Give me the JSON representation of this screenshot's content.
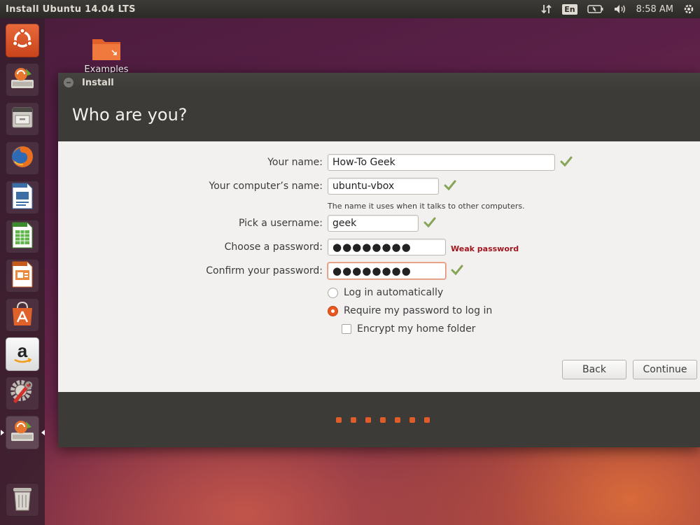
{
  "panel": {
    "title": "Install Ubuntu 14.04 LTS",
    "language": "En",
    "clock": "8:58 AM"
  },
  "desktop": {
    "icons": [
      {
        "label": "Examples",
        "icon": "folder-icon"
      }
    ]
  },
  "launcher": {
    "items": [
      {
        "name": "ubuntu-dash",
        "icon": "ubuntu-logo-icon"
      },
      {
        "name": "installer",
        "icon": "installer-icon"
      },
      {
        "name": "files",
        "icon": "file-cabinet-icon"
      },
      {
        "name": "firefox",
        "icon": "firefox-icon"
      },
      {
        "name": "writer",
        "icon": "writer-icon"
      },
      {
        "name": "calc",
        "icon": "calc-icon"
      },
      {
        "name": "impress",
        "icon": "impress-icon"
      },
      {
        "name": "software-center",
        "icon": "shopping-bag-icon"
      },
      {
        "name": "amazon",
        "icon": "amazon-icon"
      },
      {
        "name": "system-settings",
        "icon": "settings-icon"
      },
      {
        "name": "installer-running",
        "icon": "installer-icon"
      },
      {
        "name": "trash",
        "icon": "trash-icon"
      }
    ]
  },
  "window": {
    "title": "Install",
    "page_title": "Who are you?"
  },
  "form": {
    "your_name": {
      "label": "Your name:",
      "value": "How-To Geek"
    },
    "computer_name": {
      "label": "Your computer’s name:",
      "value": "ubuntu-vbox",
      "hint": "The name it uses when it talks to other computers."
    },
    "username": {
      "label": "Pick a username:",
      "value": "geek"
    },
    "password": {
      "label": "Choose a password:",
      "value": "●●●●●●●●",
      "strength": "Weak password"
    },
    "confirm_password": {
      "label": "Confirm your password:",
      "value": "●●●●●●●●"
    },
    "login_auto": {
      "label": "Log in automatically",
      "selected": false
    },
    "login_password": {
      "label": "Require my password to log in",
      "selected": true
    },
    "encrypt_home": {
      "label": "Encrypt my home folder",
      "checked": false
    }
  },
  "buttons": {
    "back": "Back",
    "continue": "Continue"
  },
  "progress": {
    "steps_total": 7
  },
  "colors": {
    "accent": "#dd4814",
    "valid": "#87a556",
    "error": "#a1161d"
  }
}
